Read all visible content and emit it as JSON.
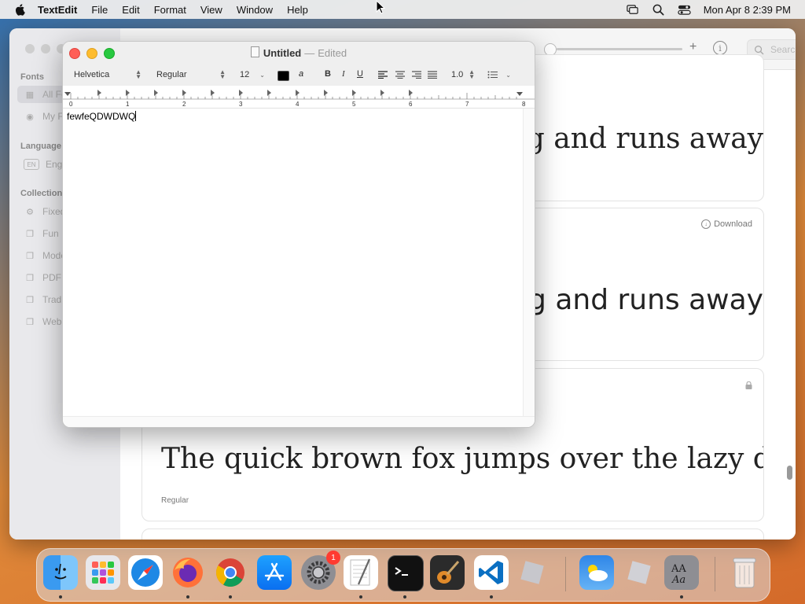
{
  "menubar": {
    "app_name": "TextEdit",
    "menus": [
      "File",
      "Edit",
      "Format",
      "View",
      "Window",
      "Help"
    ],
    "clock": "Mon Apr 8  2:39 PM"
  },
  "fontbook": {
    "sidebar": {
      "fonts_heading": "Fonts",
      "all_fonts": "All Fonts",
      "my_fonts": "My Fonts",
      "language_heading": "Language",
      "language_badge": "EN",
      "english": "English",
      "collections_heading": "Collections",
      "collections": [
        "Fixed Width",
        "Fun",
        "Modern",
        "PDF",
        "Traditional",
        "Web"
      ]
    },
    "search_placeholder": "Search",
    "cards": [
      {
        "sample": "The quick brown fox jumps over the lazy dog and runs away.",
        "style": ""
      },
      {
        "sample": "The quick brown fox jumps over the lazy dog and runs away.",
        "download": "Download"
      },
      {
        "sample": "The quick brown fox jumps over the lazy dog and runs away.",
        "style": "Regular"
      }
    ]
  },
  "textedit": {
    "title": "Untitled",
    "separator": "—",
    "status": "Edited",
    "font_family": "Helvetica",
    "font_style": "Regular",
    "font_size": "12",
    "line_spacing": "1.0",
    "bold": "B",
    "italic": "I",
    "underline": "U",
    "highlight": "a",
    "ruler_labels": [
      "0",
      "1",
      "2",
      "3",
      "4",
      "5",
      "6",
      "7",
      "8"
    ],
    "document_text": "fewfeQDWDWQ"
  },
  "dock": {
    "apps": [
      "Finder",
      "Launchpad",
      "Safari",
      "Firefox",
      "Chrome",
      "App Store",
      "System Settings",
      "TextEdit",
      "Terminal",
      "GarageBand",
      "Visual Studio Code",
      "Roblox",
      "Weather",
      "Roblox Studio",
      "Font Book",
      "Trash"
    ],
    "settings_badge": "1"
  }
}
